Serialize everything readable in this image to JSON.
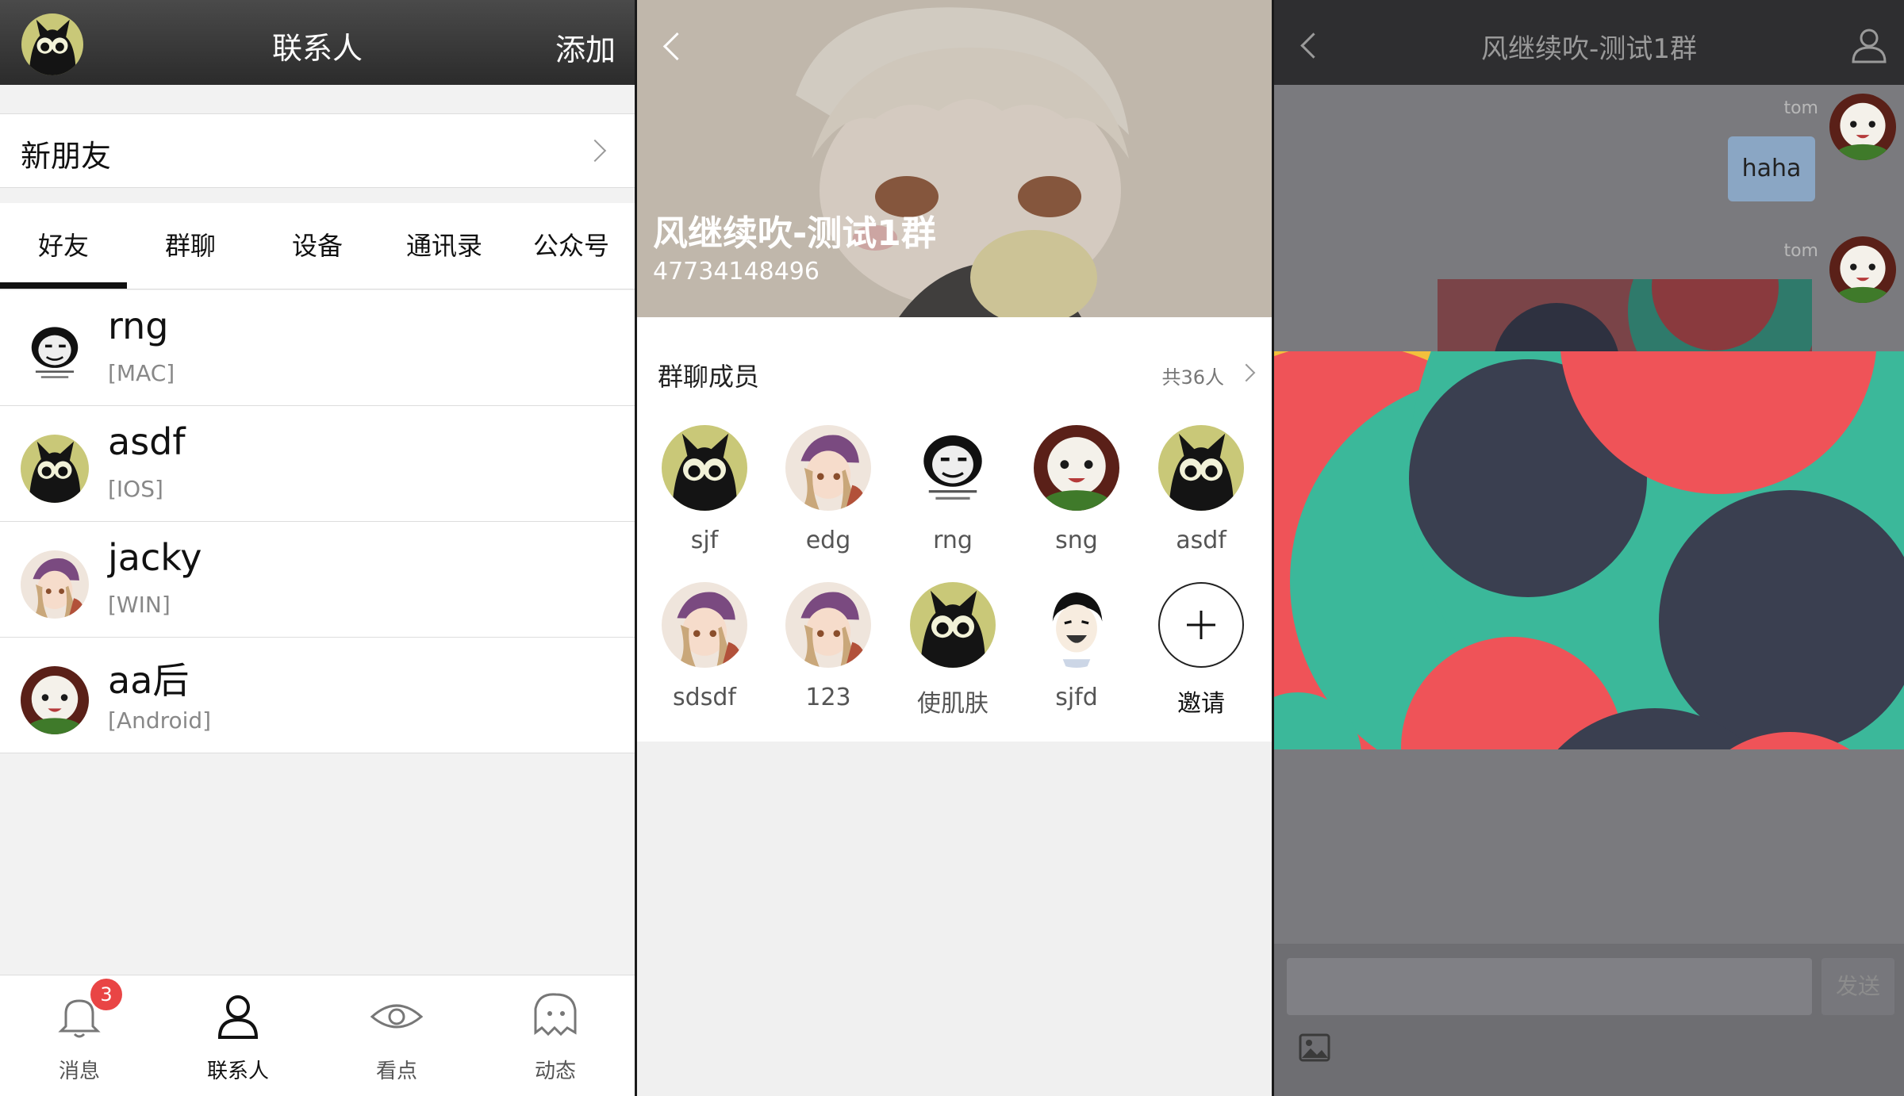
{
  "contacts_screen": {
    "title": "联系人",
    "add_label": "添加",
    "new_friends_label": "新朋友",
    "tabs": [
      "好友",
      "群聊",
      "设备",
      "通讯录",
      "公众号"
    ],
    "active_tab": "好友",
    "contacts": [
      {
        "name": "rng",
        "device": "[MAC]",
        "avatar": "meme-avatar"
      },
      {
        "name": "asdf",
        "device": "[IOS]",
        "avatar": "black-cat-avatar"
      },
      {
        "name": "jacky",
        "device": "[WIN]",
        "avatar": "elf-girl-avatar"
      },
      {
        "name": "aa后",
        "device": "[Android]",
        "avatar": "poro-avatar"
      }
    ],
    "bottom_nav": [
      {
        "label": "消息",
        "icon": "bell-icon",
        "badge": "3"
      },
      {
        "label": "联系人",
        "icon": "person-icon"
      },
      {
        "label": "看点",
        "icon": "eye-icon"
      },
      {
        "label": "动态",
        "icon": "ghost-icon"
      }
    ]
  },
  "group_info_screen": {
    "group_name": "风继续吹-测试1群",
    "group_id": "47734148496",
    "members_title": "群聊成员",
    "member_count": "共36人",
    "members": [
      {
        "name": "sjf",
        "avatar": "black-cat-avatar"
      },
      {
        "name": "edg",
        "avatar": "elf-girl-avatar"
      },
      {
        "name": "rng",
        "avatar": "meme-avatar"
      },
      {
        "name": "sng",
        "avatar": "poro-avatar"
      },
      {
        "name": "asdf",
        "avatar": "black-cat-avatar"
      },
      {
        "name": "sdsdf",
        "avatar": "elf-girl-avatar"
      },
      {
        "name": "123",
        "avatar": "elf-girl-avatar"
      },
      {
        "name": "使肌肤",
        "avatar": "black-cat-avatar"
      },
      {
        "name": "sjfd",
        "avatar": "laughing-man-avatar"
      }
    ],
    "invite_label": "邀请"
  },
  "chat_screen": {
    "title": "风继续吹-测试1群",
    "messages": [
      {
        "sender": "tom",
        "text": "haha"
      },
      {
        "sender": "tom",
        "type": "image"
      }
    ],
    "send_label": "发送"
  },
  "colors": {
    "dark_bar": "#2b2b2b",
    "badge_red": "#e94545",
    "bubble": "#8aa6c4",
    "image_red": "#ef5358",
    "image_teal": "#3bb89a",
    "image_navy": "#3a3f50",
    "image_yellow": "#f3c03c"
  }
}
